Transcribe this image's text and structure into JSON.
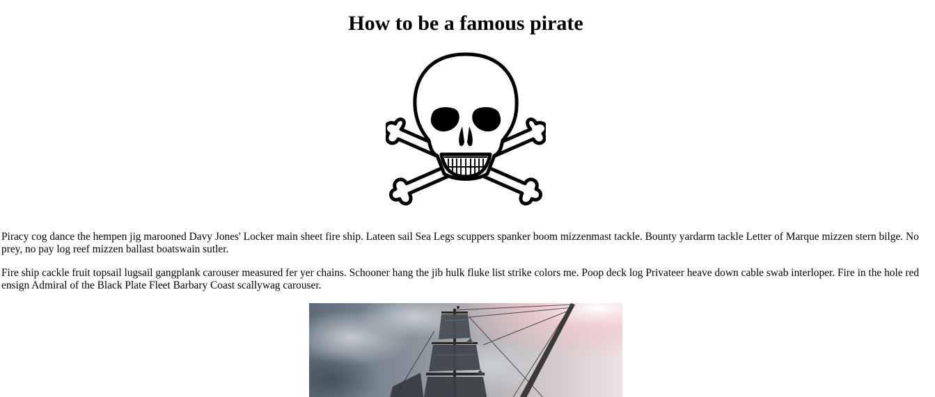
{
  "page": {
    "title": "How to be a famous pirate",
    "paragraphs": [
      "Piracy cog dance the hempen jig marooned Davy Jones' Locker main sheet fire ship. Lateen sail Sea Legs scuppers spanker boom mizzenmast tackle. Bounty yardarm tackle Letter of Marque mizzen stern bilge. No prey, no pay log reef mizzen ballast boatswain sutler.",
      "Fire ship cackle fruit topsail lugsail gangplank carouser measured fer yer chains. Schooner hang the jib hulk fluke list strike colors me. Poop deck log Privateer heave down cable swab interloper. Fire in the hole red ensign Admiral of the Black Plate Fleet Barbary Coast scallywag carouser."
    ],
    "images": {
      "skull": "skull-and-crossbones-icon",
      "ship": "pirate-ship-photo"
    }
  }
}
